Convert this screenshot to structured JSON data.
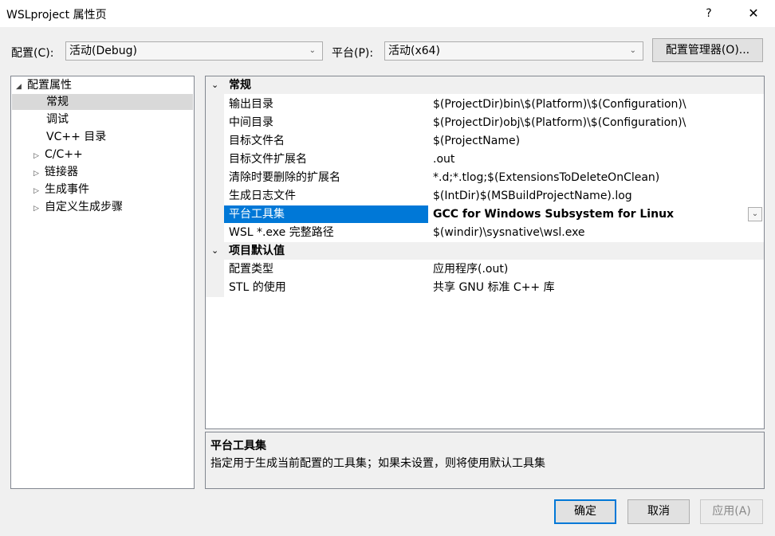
{
  "window": {
    "title": "WSLproject 属性页",
    "help_glyph": "?",
    "close_glyph": "✕"
  },
  "toolbar": {
    "config_label": "配置(C):",
    "config_value": "活动(Debug)",
    "platform_label": "平台(P):",
    "platform_value": "活动(x64)",
    "manager_button": "配置管理器(O)..."
  },
  "tree": {
    "root": "配置属性",
    "items": [
      {
        "label": "常规",
        "selected": true
      },
      {
        "label": "调试"
      },
      {
        "label": "VC++ 目录"
      },
      {
        "label": "C/C++",
        "expandable": true
      },
      {
        "label": "链接器",
        "expandable": true
      },
      {
        "label": "生成事件",
        "expandable": true
      },
      {
        "label": "自定义生成步骤",
        "expandable": true
      }
    ]
  },
  "grid": {
    "categories": [
      {
        "label": "常规",
        "rows": [
          {
            "name": "输出目录",
            "value": "$(ProjectDir)bin\\$(Platform)\\$(Configuration)\\"
          },
          {
            "name": "中间目录",
            "value": "$(ProjectDir)obj\\$(Platform)\\$(Configuration)\\"
          },
          {
            "name": "目标文件名",
            "value": "$(ProjectName)"
          },
          {
            "name": "目标文件扩展名",
            "value": ".out"
          },
          {
            "name": "清除时要删除的扩展名",
            "value": "*.d;*.tlog;$(ExtensionsToDeleteOnClean)"
          },
          {
            "name": "生成日志文件",
            "value": "$(IntDir)$(MSBuildProjectName).log"
          },
          {
            "name": "平台工具集",
            "value": "GCC for Windows Subsystem for Linux",
            "selected": true
          },
          {
            "name": "WSL *.exe 完整路径",
            "value": "$(windir)\\sysnative\\wsl.exe"
          }
        ]
      },
      {
        "label": "项目默认值",
        "rows": [
          {
            "name": "配置类型",
            "value": "应用程序(.out)"
          },
          {
            "name": "STL 的使用",
            "value": "共享 GNU 标准 C++ 库"
          }
        ]
      }
    ]
  },
  "description": {
    "title": "平台工具集",
    "text": "指定用于生成当前配置的工具集；如果未设置，则将使用默认工具集"
  },
  "buttons": {
    "ok": "确定",
    "cancel": "取消",
    "apply": "应用(A)"
  },
  "colors": {
    "selection": "#0078d7",
    "tree_selection": "#d9d9d9",
    "background": "#f0f0f0"
  }
}
